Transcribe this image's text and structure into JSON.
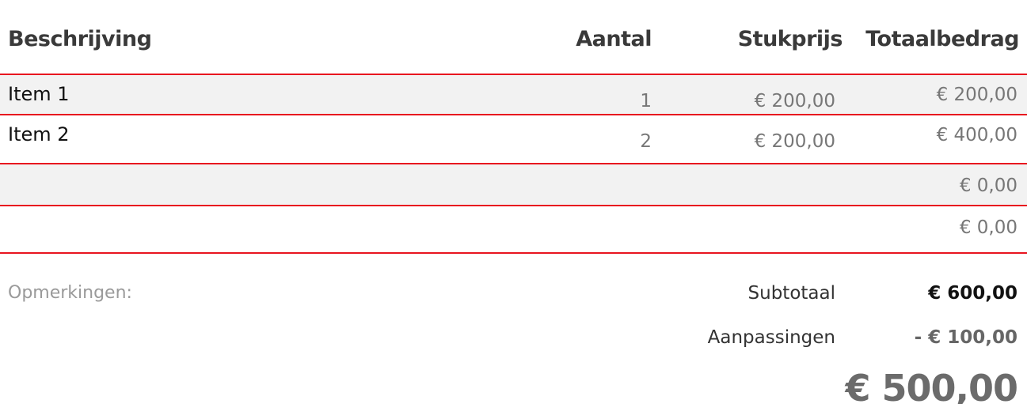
{
  "table": {
    "headers": {
      "description": "Beschrijving",
      "quantity": "Aantal",
      "unit_price": "Stukprijs",
      "total": "Totaalbedrag"
    },
    "rows": [
      {
        "description": "Item 1",
        "quantity": "1",
        "unit_price": "€ 200,00",
        "total": "€ 200,00"
      },
      {
        "description": "Item 2",
        "quantity": "2",
        "unit_price": "€ 200,00",
        "total": "€ 400,00"
      },
      {
        "description": "",
        "quantity": "",
        "unit_price": "",
        "total": "€ 0,00"
      },
      {
        "description": "",
        "quantity": "",
        "unit_price": "",
        "total": "€ 0,00"
      }
    ]
  },
  "notes": {
    "label": "Opmerkingen:"
  },
  "summary": {
    "subtotal_label": "Subtotaal",
    "subtotal_value": "€ 600,00",
    "adjustments_label": "Aanpassingen",
    "adjustments_value": "- € 100,00",
    "grand_total": "€ 500,00"
  },
  "colors": {
    "rule": "#e8141f",
    "shaded_row": "#f2f2f2"
  }
}
